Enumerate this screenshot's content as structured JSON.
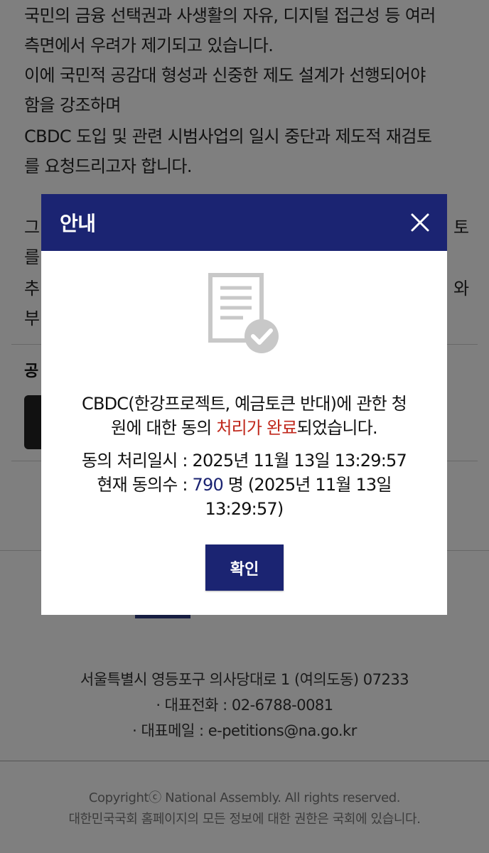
{
  "background": {
    "body_lines": [
      "국민의 금융 선택권과 사생활의 자유, 디지털 접근성 등 여러",
      "측면에서 우려가 제기되고 있습니다.",
      "이에 국민적 공감대 형성과 신중한 제도 설계가 선행되어야",
      "함을 강조하며",
      "CBDC 도입 및 관련 시범사업의 일시 중단과 제도적 재검토",
      "를 요청드리고자 합니다."
    ],
    "partial_lines": [
      "그",
      "를",
      "추",
      "부"
    ],
    "partial_right": [
      "토",
      "",
      "와",
      ""
    ],
    "share_label": "공"
  },
  "footer": {
    "address": "서울특별시 영등포구 의사당대로 1 (여의도동) 07233",
    "phone": "· 대표전화 : 02-6788-0081",
    "email": "· 대표메일 : e-petitions@na.go.kr",
    "copyright": "Copyrightⓒ National Assembly. All rights reserved.",
    "rights_notice": "대한민국국회 홈페이지의 모든 정보에 대한 권한은 국회에 있습니다."
  },
  "modal": {
    "title": "안내",
    "close_icon": "close-icon",
    "doc_icon": "document-check-icon",
    "message_prefix": "CBDC(한강프로젝트, 예금토큰 반대)에 관한 청",
    "message_line2_prefix": "원에 대한 동의 ",
    "message_highlight": "처리가 완료",
    "message_suffix": "되었습니다.",
    "processed_label": "동의 처리일시 : 2025년 11월 13일 13:29:57",
    "count_label": "현재 동의수 : ",
    "count_value": "790",
    "count_suffix": " 명 (2025년 11월 13일",
    "count_time": "13:29:57)",
    "confirm_label": "확인"
  },
  "colors": {
    "header_bg": "#1b2472",
    "highlight": "#c0281c",
    "count": "#1b2472"
  }
}
